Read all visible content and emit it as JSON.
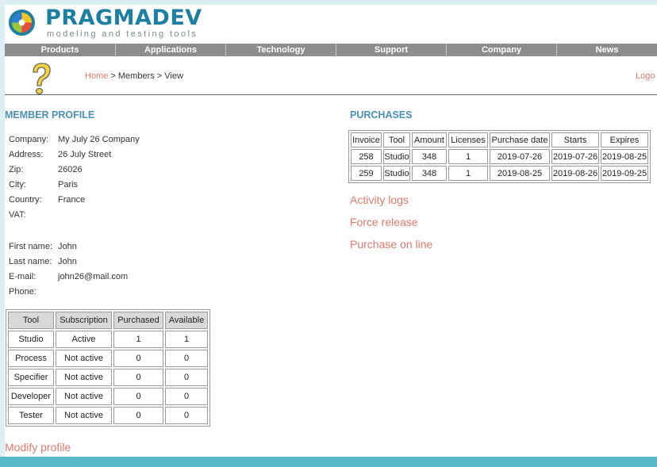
{
  "brand": {
    "name": "PRAGMADEV",
    "tagline": "modeling and testing tools"
  },
  "nav": [
    {
      "label": "Products"
    },
    {
      "label": "Applications"
    },
    {
      "label": "Technology"
    },
    {
      "label": "Support"
    },
    {
      "label": "Company"
    },
    {
      "label": "News"
    }
  ],
  "breadcrumb": {
    "home": "Home",
    "separator1": " > ",
    "members": "Members",
    "separator2": " > ",
    "current": "View"
  },
  "logout_label": "Logo",
  "profile": {
    "title": "MEMBER PROFILE",
    "company_label": "Company:",
    "company_value": "My July 26 Company",
    "address_label": "Address:",
    "address_value": "26 July Street",
    "zip_label": "Zip:",
    "zip_value": "26026",
    "city_label": "City:",
    "city_value": "Paris",
    "country_label": "Country:",
    "country_value": "France",
    "vat_label": "VAT:",
    "vat_value": "",
    "firstname_label": "First name:",
    "firstname_value": "John",
    "lastname_label": "Last name:",
    "lastname_value": "John",
    "email_label": "E-mail:",
    "email_value": "john26@mail.com",
    "phone_label": "Phone:",
    "phone_value": ""
  },
  "subscriptions": {
    "headers": [
      "Tool",
      "Subscription",
      "Purchased",
      "Available"
    ],
    "rows": [
      [
        "Studio",
        "Active",
        "1",
        "1"
      ],
      [
        "Process",
        "Not active",
        "0",
        "0"
      ],
      [
        "Specifier",
        "Not active",
        "0",
        "0"
      ],
      [
        "Developer",
        "Not active",
        "0",
        "0"
      ],
      [
        "Tester",
        "Not active",
        "0",
        "0"
      ]
    ]
  },
  "modify_profile": "Modify profile",
  "purchases": {
    "title": "PURCHASES",
    "headers": [
      "Invoice",
      "Tool",
      "Amount",
      "Licenses",
      "Purchase date",
      "Starts",
      "Expires"
    ],
    "rows": [
      [
        "258",
        "Studio",
        "348",
        "1",
        "2019-07-26",
        "2019-07-26",
        "2019-08-25"
      ],
      [
        "259",
        "Studio",
        "348",
        "1",
        "2019-08-25",
        "2019-08-26",
        "2019-09-25"
      ]
    ]
  },
  "links": {
    "activity_logs": "Activity logs",
    "force_release": "Force release",
    "purchase_online": "Purchase on line"
  },
  "colors": {
    "accent_link": "#e07a6a",
    "section_title": "#4a90b8",
    "brand_blue": "#1d7fa1",
    "nav_bg": "#8d8d8d",
    "frame": "#55b9c6"
  },
  "icons": {
    "logo": "pragmadev-logo-icon",
    "help": "question-mark-icon"
  }
}
